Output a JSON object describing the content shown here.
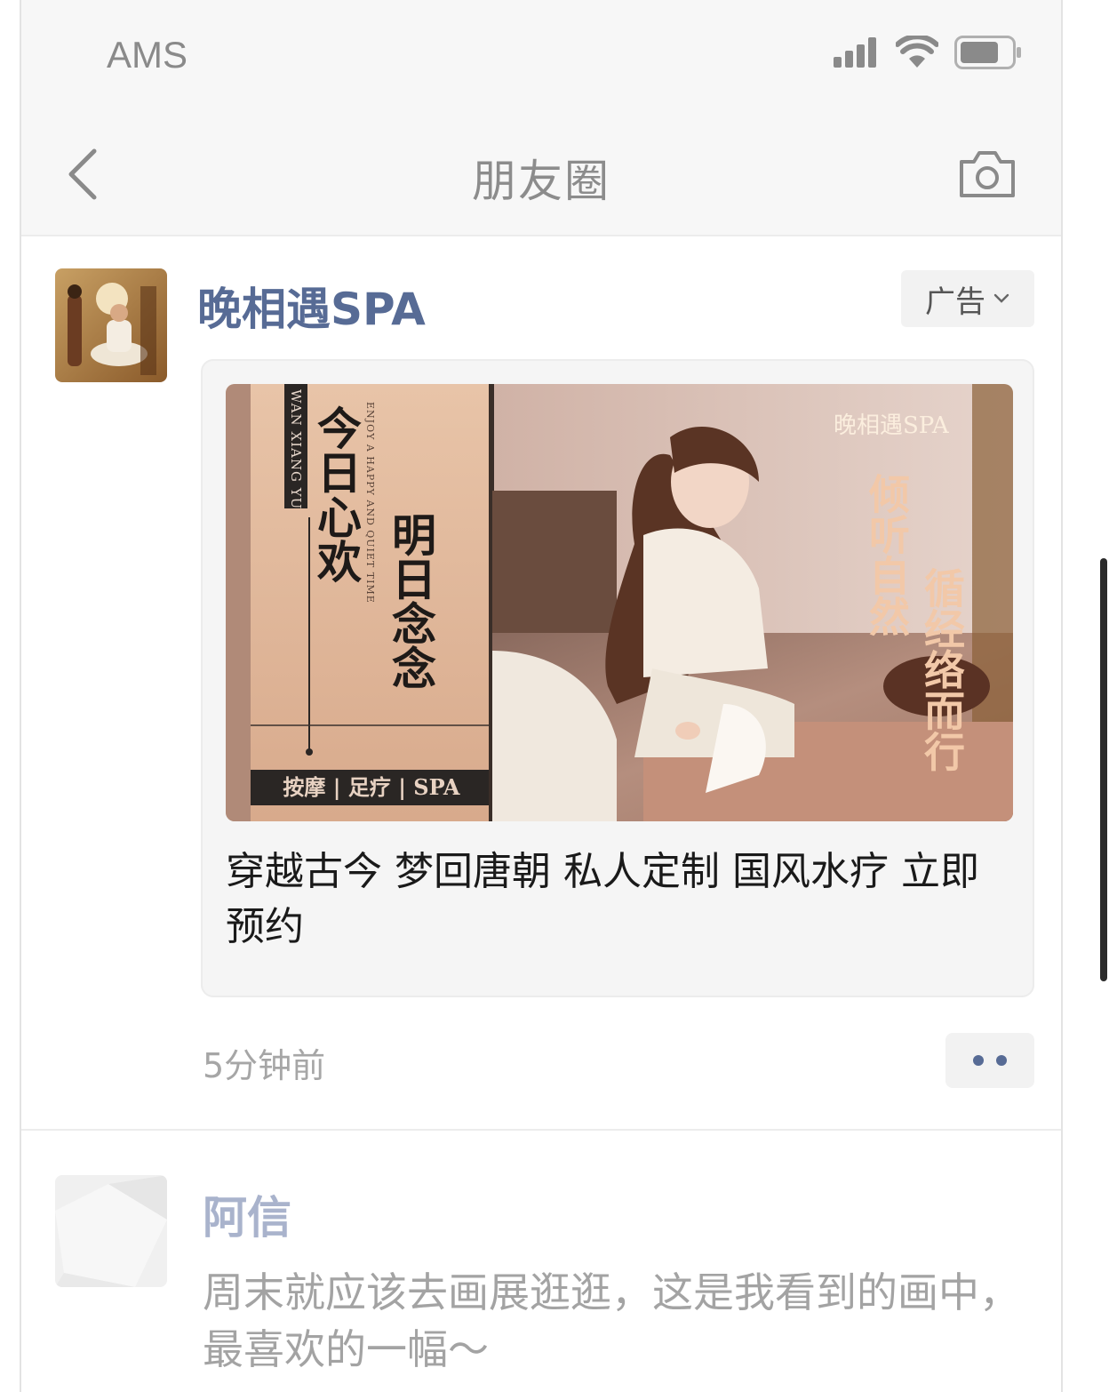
{
  "status_bar": {
    "carrier": "AMS",
    "icons": [
      "signal-icon",
      "wifi-icon",
      "battery-icon"
    ]
  },
  "nav": {
    "title": "朋友圈",
    "back_icon": "chevron-left-icon",
    "camera_icon": "camera-icon"
  },
  "moments": [
    {
      "author": "晚相遇SPA",
      "ad_label": "广告",
      "ad_image": {
        "latin_vertical": "WAN XIANG YU",
        "english_vertical": "ENJOY A HAPPY AND QUIET TIME",
        "headline_1": "今日心欢",
        "headline_2": "明日念念",
        "services": "按摩 | 足疗 | SPA",
        "brand": "晚相遇SPA",
        "slogan_1": "倾听自然",
        "slogan_2": "循经络而行"
      },
      "ad_text": "穿越古今 梦回唐朝 私人定制 国风水疗 立即预约",
      "time": "5分钟前"
    },
    {
      "author": "阿信",
      "text": "周末就应该去画展逛逛，这是我看到的画中，最喜欢的一幅～"
    }
  ],
  "colors": {
    "link_blue": "#576b95",
    "muted_text": "#a6a6a6",
    "bar_bg": "#f7f7f7"
  }
}
